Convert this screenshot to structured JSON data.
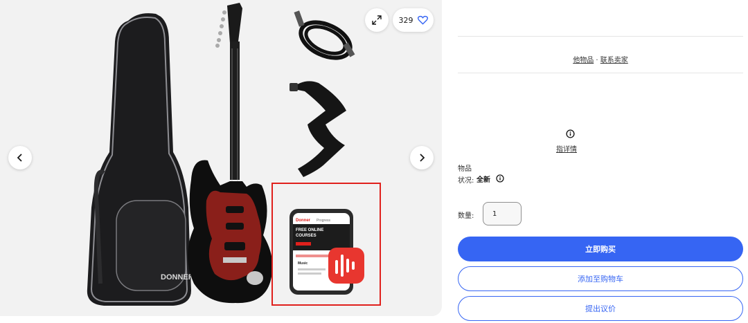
{
  "gallery": {
    "watch_count": "329",
    "brand_on_bag": "DONNER",
    "accent_colors": {
      "highlight": "#e0201c",
      "pickguard": "#8a1f1a",
      "app_icon": "#e8362f"
    },
    "phone_screen": {
      "brand": "Donner",
      "tab": "Progress",
      "headline_line1": "FREE ONLINE",
      "headline_line2": "COURSES",
      "section": "Music"
    }
  },
  "seller": {
    "other_items": "他物品",
    "separator": " · ",
    "contact_seller": "联系卖家"
  },
  "details_link": "指详情",
  "condition": {
    "label": "物品状况:",
    "value": "全新"
  },
  "quantity": {
    "label": "数量:",
    "value": "1"
  },
  "actions": {
    "buy_now": "立即购买",
    "add_to_cart": "添加至购物车",
    "make_offer": "提出议价"
  },
  "colors": {
    "primary": "#3665f3",
    "divider": "#e5e5e5"
  }
}
